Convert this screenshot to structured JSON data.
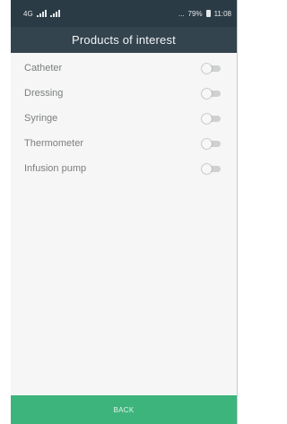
{
  "status_bar": {
    "network": "4G",
    "signal_icons": [
      "signal-icon",
      "signal-icon"
    ],
    "notification": "...",
    "battery_percent": "79%",
    "battery_icon": "battery-icon",
    "time": "11:08"
  },
  "header": {
    "title": "Products of interest"
  },
  "products": [
    {
      "label": "Catheter",
      "enabled": false
    },
    {
      "label": "Dressing",
      "enabled": false
    },
    {
      "label": "Syringe",
      "enabled": false
    },
    {
      "label": "Thermometer",
      "enabled": false
    },
    {
      "label": "Infusion pump",
      "enabled": false
    }
  ],
  "footer": {
    "back_label": "BACK"
  },
  "colors": {
    "status_bar": "#2b3b46",
    "title_bar": "#34444f",
    "background": "#f5f6f5",
    "back_button": "#3cb47c"
  }
}
